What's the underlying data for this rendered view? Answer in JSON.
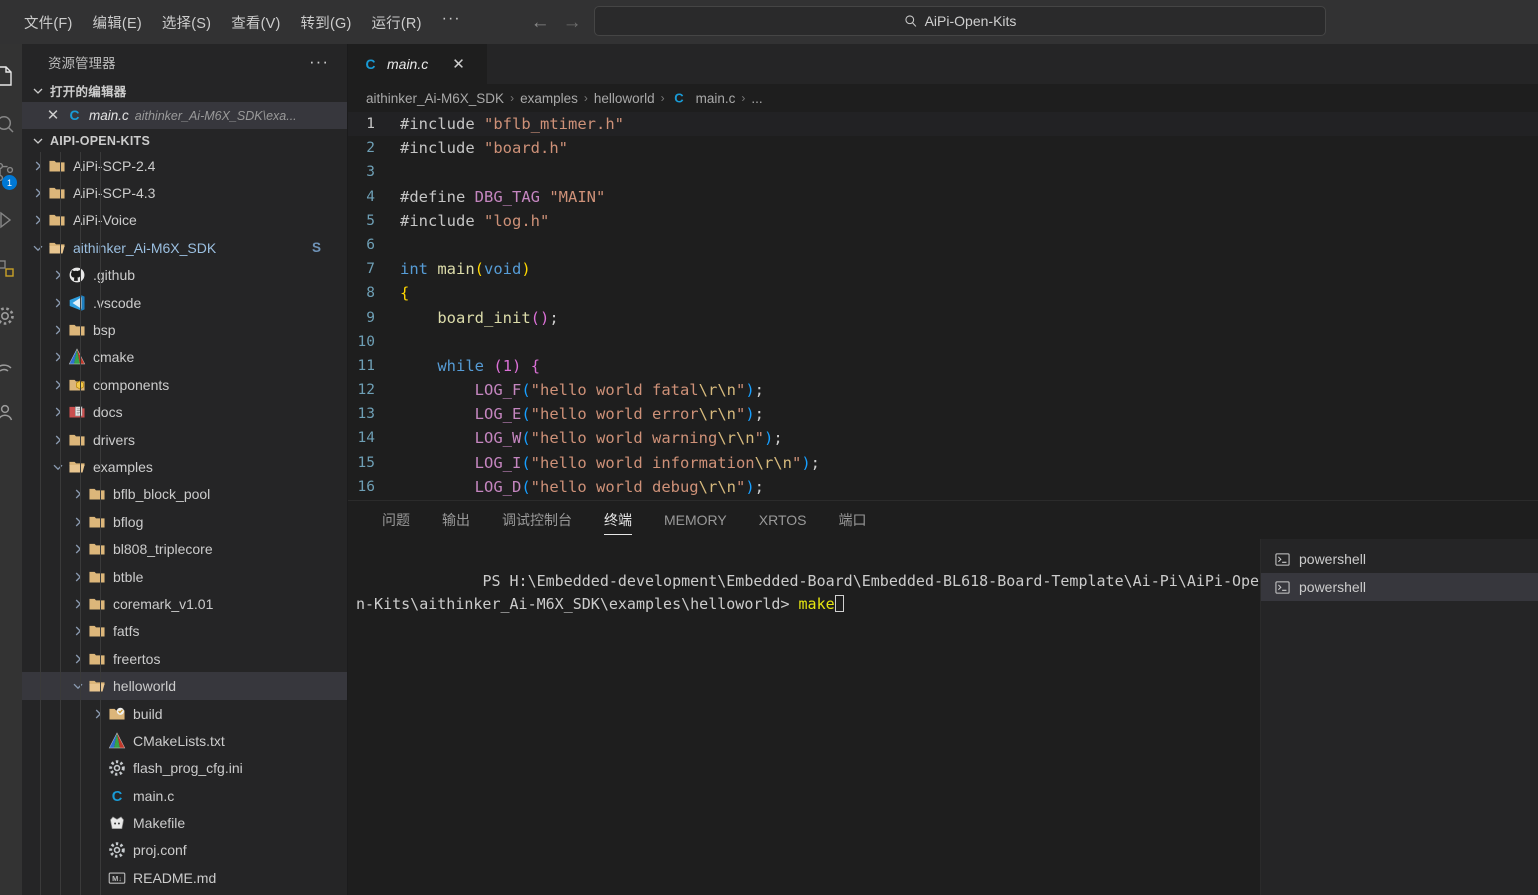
{
  "titlebar": {
    "menus": [
      {
        "label": "文件(F)",
        "name": "menu-file"
      },
      {
        "label": "编辑(E)",
        "name": "menu-edit"
      },
      {
        "label": "选择(S)",
        "name": "menu-selection"
      },
      {
        "label": "查看(V)",
        "name": "menu-view"
      },
      {
        "label": "转到(G)",
        "name": "menu-go"
      },
      {
        "label": "运行(R)",
        "name": "menu-run"
      }
    ],
    "more_label": "···",
    "back_arrow": "←",
    "forward_arrow": "→",
    "quickinput_value": "AiPi-Open-Kits",
    "quickinput_placeholder": "AiPi-Open-Kits"
  },
  "activitybar": {
    "source_control_badge": "1"
  },
  "sidebar": {
    "title": "资源管理器",
    "more_label": "···",
    "open_editors": {
      "header": "打开的编辑器",
      "items": [
        {
          "name": "main.c",
          "path": "aithinker_Ai-M6X_SDK\\exa...",
          "icon": "c-file-icon",
          "close": "✕"
        }
      ]
    },
    "workspace": {
      "header": "AIPI-OPEN-KITS",
      "items": [
        {
          "label": "AiPi-SCP-2.4",
          "icon": "folder-icon",
          "indent": 1,
          "state": "collapsed",
          "type": "folder"
        },
        {
          "label": "AiPi-SCP-4.3",
          "icon": "folder-icon",
          "indent": 1,
          "state": "collapsed",
          "type": "folder"
        },
        {
          "label": "AiPi-Voice",
          "icon": "folder-icon",
          "indent": 1,
          "state": "collapsed",
          "type": "folder"
        },
        {
          "label": "aithinker_Ai-M6X_SDK",
          "icon": "folder-open-icon",
          "indent": 1,
          "state": "expanded",
          "type": "folder",
          "badge": "S"
        },
        {
          "label": ".github",
          "icon": "github-icon",
          "indent": 2,
          "state": "collapsed",
          "type": "folder"
        },
        {
          "label": ".vscode",
          "icon": "vscode-icon",
          "indent": 2,
          "state": "collapsed",
          "type": "folder"
        },
        {
          "label": "bsp",
          "icon": "folder-icon",
          "indent": 2,
          "state": "collapsed",
          "type": "folder"
        },
        {
          "label": "cmake",
          "icon": "cmake-icon",
          "indent": 2,
          "state": "collapsed",
          "type": "folder"
        },
        {
          "label": "components",
          "icon": "components-icon",
          "indent": 2,
          "state": "collapsed",
          "type": "folder"
        },
        {
          "label": "docs",
          "icon": "docs-icon",
          "indent": 2,
          "state": "collapsed",
          "type": "folder"
        },
        {
          "label": "drivers",
          "icon": "folder-icon",
          "indent": 2,
          "state": "collapsed",
          "type": "folder"
        },
        {
          "label": "examples",
          "icon": "folder-open-icon",
          "indent": 2,
          "state": "expanded",
          "type": "folder"
        },
        {
          "label": "bflb_block_pool",
          "icon": "folder-icon",
          "indent": 3,
          "state": "collapsed",
          "type": "folder"
        },
        {
          "label": "bflog",
          "icon": "folder-icon",
          "indent": 3,
          "state": "collapsed",
          "type": "folder"
        },
        {
          "label": "bl808_triplecore",
          "icon": "folder-icon",
          "indent": 3,
          "state": "collapsed",
          "type": "folder"
        },
        {
          "label": "btble",
          "icon": "folder-icon",
          "indent": 3,
          "state": "collapsed",
          "type": "folder"
        },
        {
          "label": "coremark_v1.01",
          "icon": "folder-icon",
          "indent": 3,
          "state": "collapsed",
          "type": "folder"
        },
        {
          "label": "fatfs",
          "icon": "folder-icon",
          "indent": 3,
          "state": "collapsed",
          "type": "folder"
        },
        {
          "label": "freertos",
          "icon": "folder-icon",
          "indent": 3,
          "state": "collapsed",
          "type": "folder"
        },
        {
          "label": "helloworld",
          "icon": "folder-open-icon",
          "indent": 3,
          "state": "expanded",
          "type": "folder",
          "selected": true
        },
        {
          "label": "build",
          "icon": "build-folder-icon",
          "indent": 4,
          "state": "collapsed",
          "type": "folder"
        },
        {
          "label": "CMakeLists.txt",
          "icon": "cmake-icon",
          "indent": 4,
          "state": "none",
          "type": "file"
        },
        {
          "label": "flash_prog_cfg.ini",
          "icon": "gear-icon",
          "indent": 4,
          "state": "none",
          "type": "file"
        },
        {
          "label": "main.c",
          "icon": "c-file-icon",
          "indent": 4,
          "state": "none",
          "type": "file"
        },
        {
          "label": "Makefile",
          "icon": "makefile-icon",
          "indent": 4,
          "state": "none",
          "type": "file"
        },
        {
          "label": "proj.conf",
          "icon": "gear-icon",
          "indent": 4,
          "state": "none",
          "type": "file"
        },
        {
          "label": "README.md",
          "icon": "markdown-icon",
          "indent": 4,
          "state": "none",
          "type": "file"
        }
      ]
    }
  },
  "editor": {
    "tabs": [
      {
        "label": "main.c",
        "icon": "c-file-icon",
        "close": "✕",
        "active": true,
        "preview": true
      }
    ],
    "breadcrumb": [
      {
        "label": "aithinker_Ai-M6X_SDK",
        "icon": null
      },
      {
        "label": "examples",
        "icon": null
      },
      {
        "label": "helloworld",
        "icon": null
      },
      {
        "label": "main.c",
        "icon": "c-file-icon"
      },
      {
        "label": "...",
        "icon": null
      }
    ],
    "breadcrumb_separator": "›",
    "lines": [
      {
        "n": "1",
        "current": true,
        "tokens": [
          {
            "t": "#include ",
            "c": "pp"
          },
          {
            "t": "\"bflb_mtimer.h\"",
            "c": "str"
          }
        ]
      },
      {
        "n": "2",
        "tokens": [
          {
            "t": "#include ",
            "c": "pp"
          },
          {
            "t": "\"board.h\"",
            "c": "str"
          }
        ]
      },
      {
        "n": "3",
        "tokens": [
          {
            "t": "",
            "c": "pp"
          }
        ]
      },
      {
        "n": "4",
        "tokens": [
          {
            "t": "#define ",
            "c": "pp"
          },
          {
            "t": "DBG_TAG",
            "c": "mac"
          },
          {
            "t": " ",
            "c": "pp"
          },
          {
            "t": "\"MAIN\"",
            "c": "str"
          }
        ]
      },
      {
        "n": "5",
        "tokens": [
          {
            "t": "#include ",
            "c": "pp"
          },
          {
            "t": "\"log.h\"",
            "c": "str"
          }
        ]
      },
      {
        "n": "6",
        "tokens": [
          {
            "t": "",
            "c": "pp"
          }
        ]
      },
      {
        "n": "7",
        "tokens": [
          {
            "t": "int",
            "c": "kw"
          },
          {
            "t": " ",
            "c": "pp"
          },
          {
            "t": "main",
            "c": "fn"
          },
          {
            "t": "(",
            "c": "par1"
          },
          {
            "t": "void",
            "c": "kw"
          },
          {
            "t": ")",
            "c": "par1"
          }
        ]
      },
      {
        "n": "8",
        "tokens": [
          {
            "t": "{",
            "c": "par1"
          }
        ]
      },
      {
        "n": "9",
        "tokens": [
          {
            "t": "    ",
            "c": "pp"
          },
          {
            "t": "board_init",
            "c": "fn"
          },
          {
            "t": "(",
            "c": "par2"
          },
          {
            "t": ")",
            "c": "par2"
          },
          {
            "t": ";",
            "c": "punc"
          }
        ]
      },
      {
        "n": "10",
        "tokens": [
          {
            "t": "",
            "c": "pp"
          }
        ]
      },
      {
        "n": "11",
        "tokens": [
          {
            "t": "    ",
            "c": "pp"
          },
          {
            "t": "while",
            "c": "kw"
          },
          {
            "t": " ",
            "c": "pp"
          },
          {
            "t": "(",
            "c": "par2"
          },
          {
            "t": "1",
            "c": "par2"
          },
          {
            "t": ")",
            "c": "par2"
          },
          {
            "t": " ",
            "c": "pp"
          },
          {
            "t": "{",
            "c": "par2"
          }
        ]
      },
      {
        "n": "12",
        "tokens": [
          {
            "t": "        ",
            "c": "pp"
          },
          {
            "t": "LOG_F",
            "c": "mac"
          },
          {
            "t": "(",
            "c": "par3"
          },
          {
            "t": "\"hello world fatal",
            "c": "str"
          },
          {
            "t": "\\r\\n",
            "c": "esc"
          },
          {
            "t": "\"",
            "c": "str"
          },
          {
            "t": ")",
            "c": "par3"
          },
          {
            "t": ";",
            "c": "punc"
          }
        ]
      },
      {
        "n": "13",
        "tokens": [
          {
            "t": "        ",
            "c": "pp"
          },
          {
            "t": "LOG_E",
            "c": "mac"
          },
          {
            "t": "(",
            "c": "par3"
          },
          {
            "t": "\"hello world error",
            "c": "str"
          },
          {
            "t": "\\r\\n",
            "c": "esc"
          },
          {
            "t": "\"",
            "c": "str"
          },
          {
            "t": ")",
            "c": "par3"
          },
          {
            "t": ";",
            "c": "punc"
          }
        ]
      },
      {
        "n": "14",
        "tokens": [
          {
            "t": "        ",
            "c": "pp"
          },
          {
            "t": "LOG_W",
            "c": "mac"
          },
          {
            "t": "(",
            "c": "par3"
          },
          {
            "t": "\"hello world warning",
            "c": "str"
          },
          {
            "t": "\\r\\n",
            "c": "esc"
          },
          {
            "t": "\"",
            "c": "str"
          },
          {
            "t": ")",
            "c": "par3"
          },
          {
            "t": ";",
            "c": "punc"
          }
        ]
      },
      {
        "n": "15",
        "tokens": [
          {
            "t": "        ",
            "c": "pp"
          },
          {
            "t": "LOG_I",
            "c": "mac"
          },
          {
            "t": "(",
            "c": "par3"
          },
          {
            "t": "\"hello world information",
            "c": "str"
          },
          {
            "t": "\\r\\n",
            "c": "esc"
          },
          {
            "t": "\"",
            "c": "str"
          },
          {
            "t": ")",
            "c": "par3"
          },
          {
            "t": ";",
            "c": "punc"
          }
        ]
      },
      {
        "n": "16",
        "tokens": [
          {
            "t": "        ",
            "c": "pp"
          },
          {
            "t": "LOG_D",
            "c": "mac"
          },
          {
            "t": "(",
            "c": "par3"
          },
          {
            "t": "\"hello world debug",
            "c": "str"
          },
          {
            "t": "\\r\\n",
            "c": "esc"
          },
          {
            "t": "\"",
            "c": "str"
          },
          {
            "t": ")",
            "c": "par3"
          },
          {
            "t": ";",
            "c": "punc"
          }
        ]
      }
    ]
  },
  "panel": {
    "tabs": [
      {
        "label": "问题",
        "name": "tab-problems",
        "active": false
      },
      {
        "label": "输出",
        "name": "tab-output",
        "active": false
      },
      {
        "label": "调试控制台",
        "name": "tab-debug-console",
        "active": false
      },
      {
        "label": "终端",
        "name": "tab-terminal",
        "active": true
      },
      {
        "label": "MEMORY",
        "name": "tab-memory",
        "active": false
      },
      {
        "label": "XRTOS",
        "name": "tab-xrtos",
        "active": false
      },
      {
        "label": "端口",
        "name": "tab-ports",
        "active": false
      }
    ],
    "terminal": {
      "prompt": "PS H:\\Embedded-development\\Embedded-Board\\Embedded-BL618-Board-Template\\Ai-Pi\\AiPi-Open-Kits\\aithinker_Ai-M6X_SDK\\examples\\helloworld> ",
      "command": "make"
    },
    "terminal_list": [
      {
        "label": "powershell",
        "icon": "terminal-icon",
        "selected": false
      },
      {
        "label": "powershell",
        "icon": "terminal-icon",
        "selected": true
      }
    ]
  },
  "colors": {
    "accent": "#0078d4",
    "titlebar_bg": "#323233",
    "sidebar_bg": "#252526",
    "editor_bg": "#1e1e1e",
    "selection_bg": "#37373d",
    "folder_icon": "#dcb67a"
  }
}
